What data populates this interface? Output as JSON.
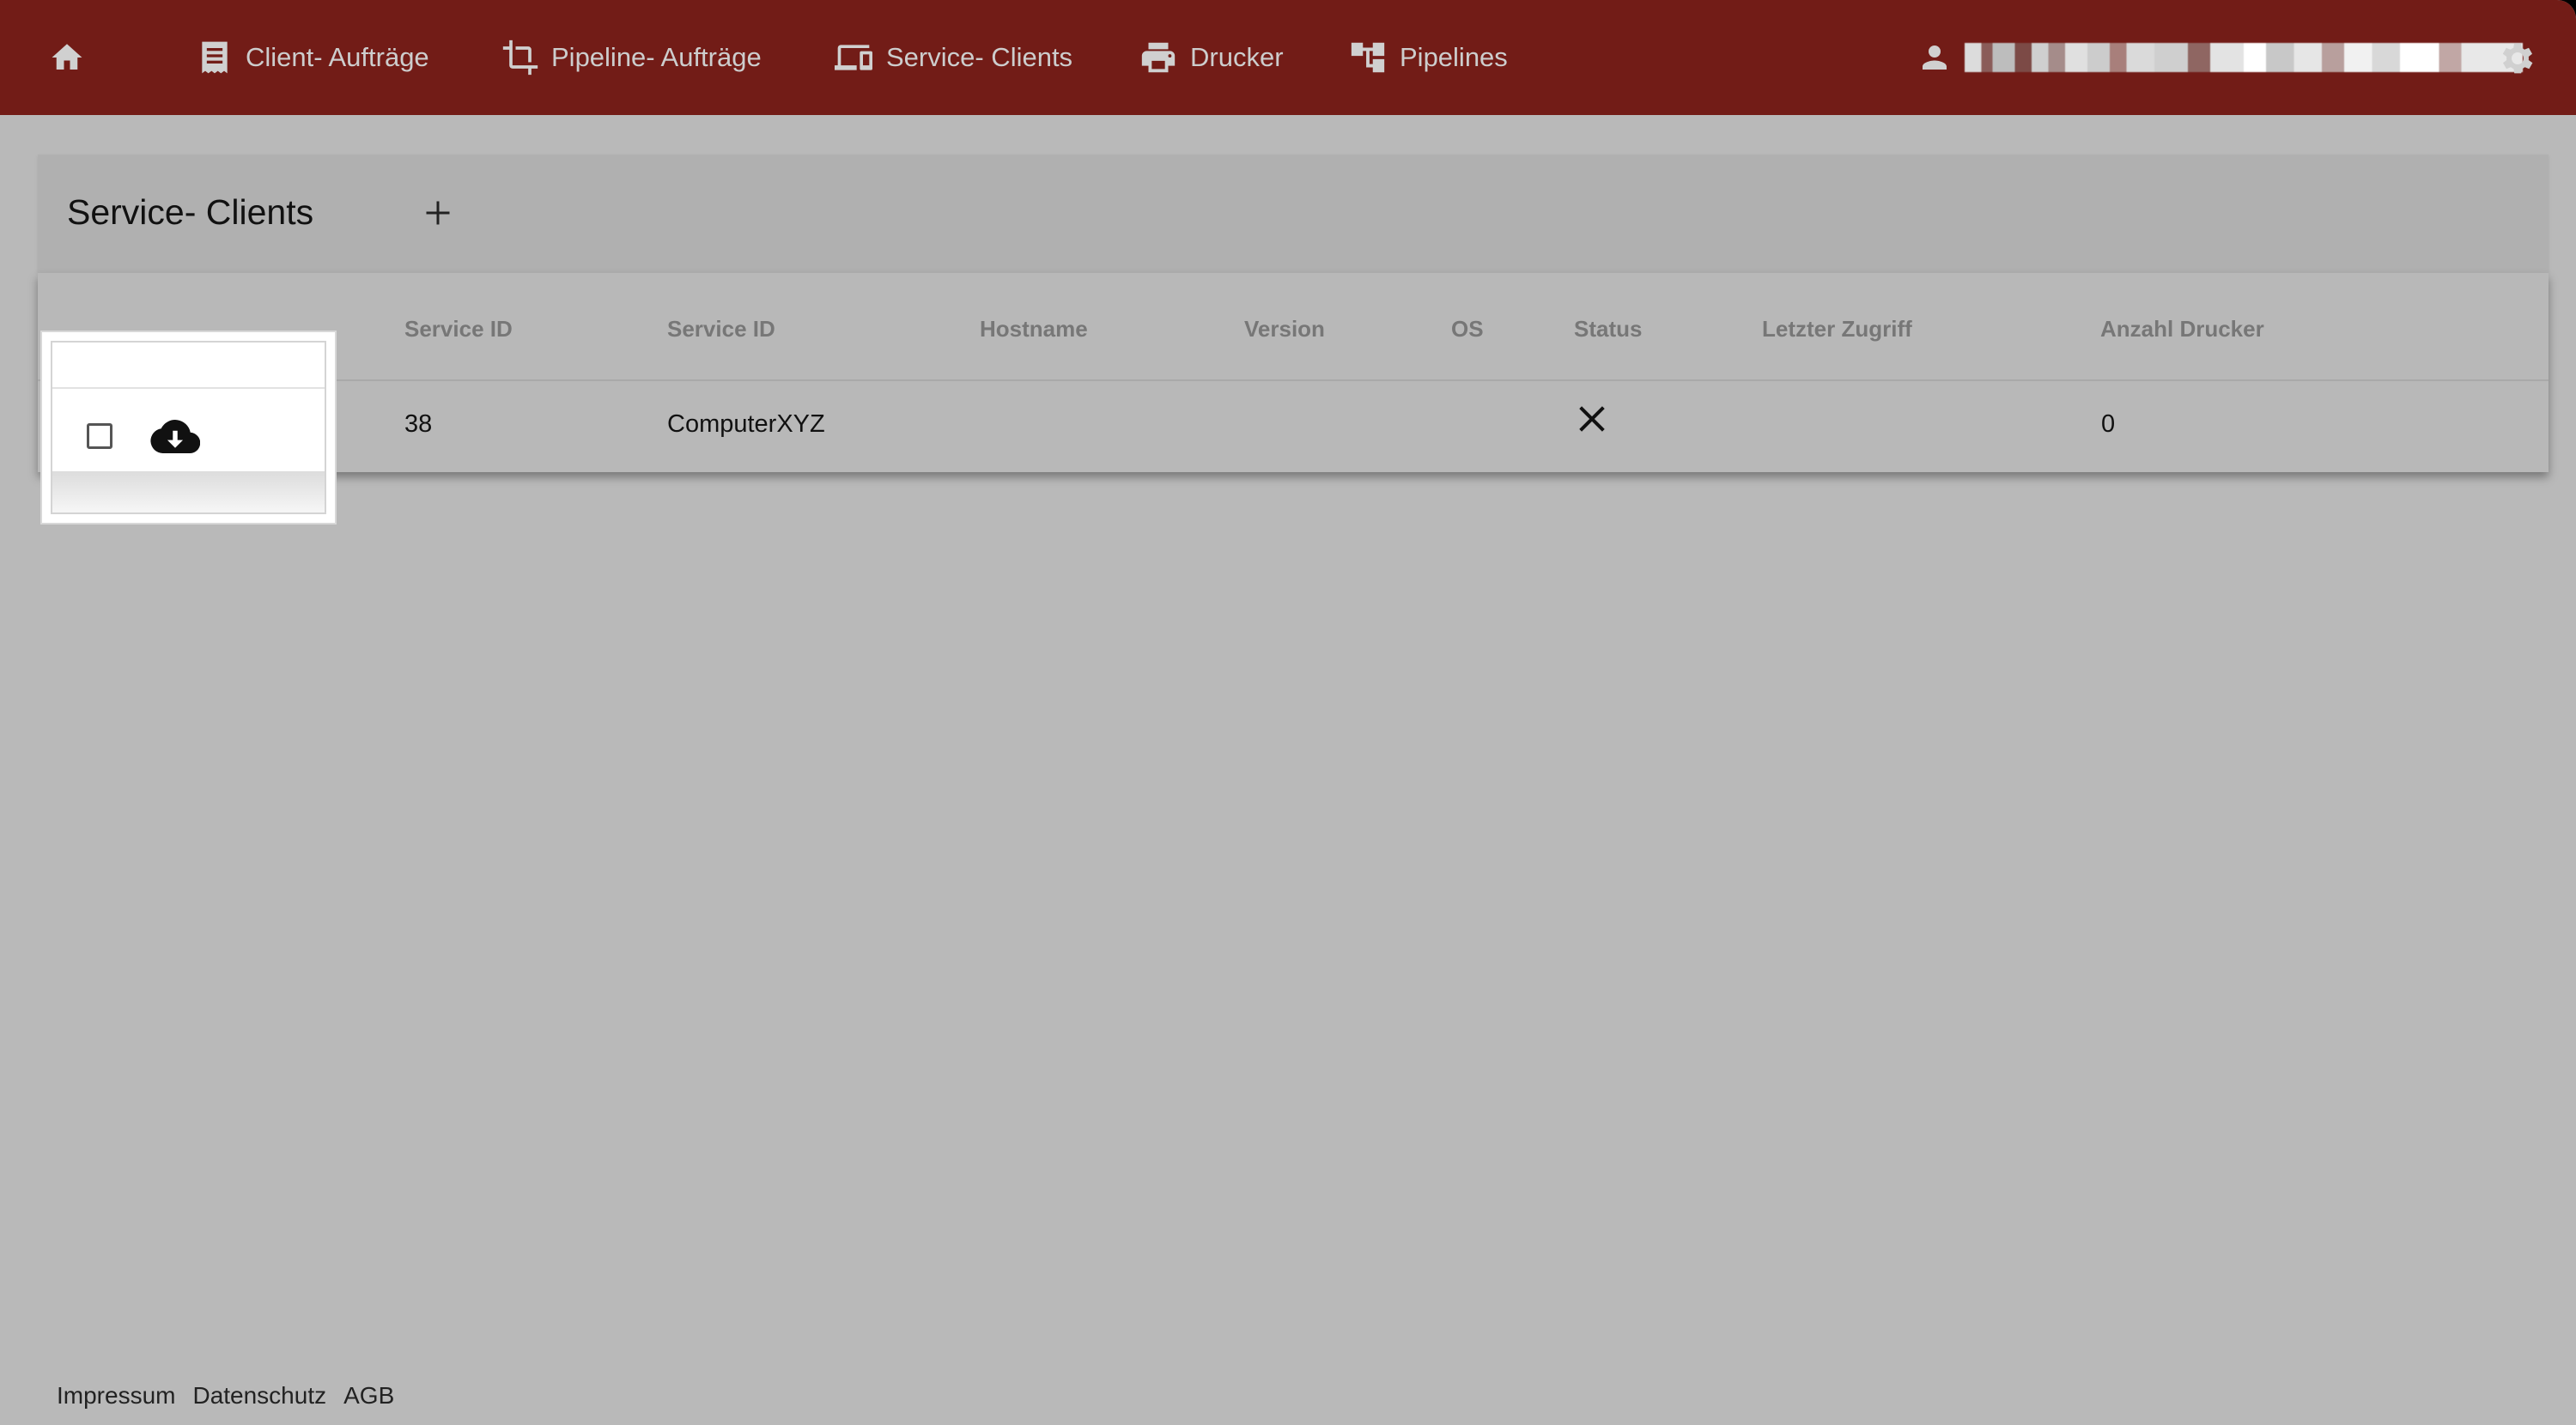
{
  "nav": {
    "home_icon": "home-icon",
    "items": [
      {
        "label": "Client- Aufträge",
        "icon": "receipt-icon"
      },
      {
        "label": "Pipeline- Aufträge",
        "icon": "crop-icon"
      },
      {
        "label": "Service- Clients",
        "icon": "devices-icon"
      },
      {
        "label": "Drucker",
        "icon": "printer-icon"
      },
      {
        "label": "Pipelines",
        "icon": "hierarchy-icon"
      }
    ],
    "user_icon": "person-icon",
    "settings_icon": "gear-icon"
  },
  "page": {
    "title": "Service- Clients",
    "add_label": "+"
  },
  "table": {
    "headers": [
      "Service ID",
      "Service ID",
      "Hostname",
      "Version",
      "OS",
      "Status",
      "Letzter Zugriff",
      "Anzahl Drucker"
    ],
    "rows": [
      {
        "service_id": "38",
        "service_name": "ComputerXYZ",
        "hostname": "",
        "version": "",
        "os": "",
        "status_icon": "close-icon",
        "last_access": "",
        "printer_count": "0"
      }
    ]
  },
  "footer": {
    "links": [
      "Impressum",
      "Datenschutz",
      "AGB"
    ]
  },
  "colors": {
    "topbar": "#721c17",
    "background": "#b9b9b9"
  }
}
